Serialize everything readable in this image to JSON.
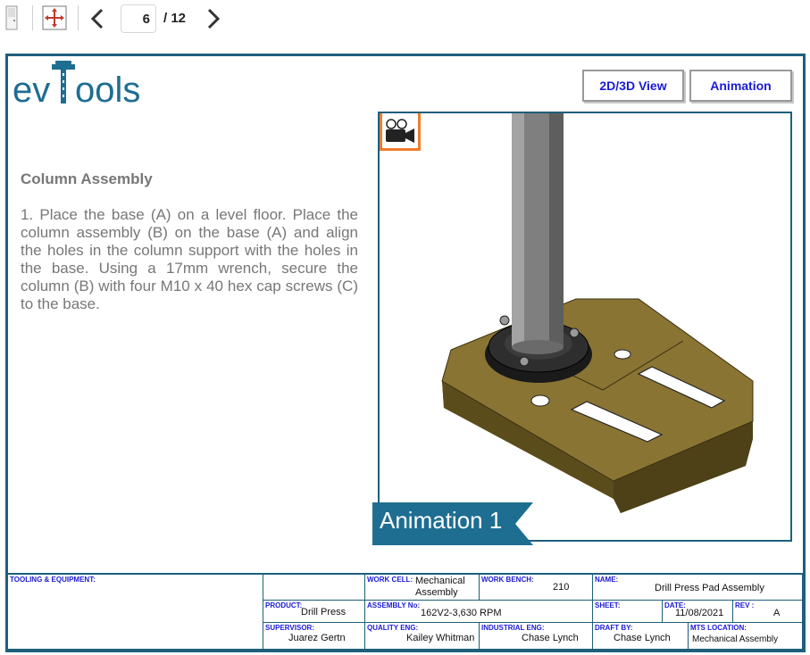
{
  "toolbar": {
    "current_page": "6",
    "total_pages": "/ 12",
    "icons": [
      "door-icon",
      "fit-screen-icon",
      "previous-page-icon",
      "next-page-icon"
    ]
  },
  "logo": {
    "text": "evtools"
  },
  "buttons": {
    "view": "2D/3D View",
    "animation": "Animation"
  },
  "content": {
    "heading": "Column Assembly",
    "instructions": "1. Place the base (A) on a level floor. Place the column assembly (B) on the base (A) and align the holes in the column support with the holes in the base. Using a 17mm wrench, secure the column (B) with four  M10 x 40 hex cap screws (C) to the base."
  },
  "viewer": {
    "camera_icon": "video-camera-icon",
    "banner": "Animation 1"
  },
  "title_block": {
    "tooling_label": "TOOLING & EQUIPMENT:",
    "work_cell_label": "WORK CELL:",
    "work_cell_line1": "Mechanical",
    "work_cell_line2": "Assembly",
    "work_bench_label": "WORK BENCH:",
    "work_bench": "210",
    "name_label": "NAME:",
    "name": "Drill Press Pad  Assembly",
    "product_label": "PRODUCT:",
    "product": "Drill Press",
    "assembly_label": "ASSEMBLY No:",
    "assembly": "162V2-3,630 RPM",
    "sheet_label": "SHEET:",
    "sheet": "",
    "date_label": "DATE:",
    "date": "11/08/2021",
    "rev_label": "REV :",
    "rev": "A",
    "supervisor_label": "SUPERVISOR:",
    "supervisor": "Juarez Gertn",
    "quality_label": "QUALITY ENG:",
    "quality": "Kailey Whitman",
    "industrial_label": "INDUSTRIAL ENG:",
    "industrial": "Chase Lynch",
    "draft_label": "DRAFT BY:",
    "draft": "Chase Lynch",
    "mts_label": "MTS LOCATION:",
    "mts": "Mechanical Assembly"
  },
  "colors": {
    "frame": "#1e5f7c",
    "accent": "#f07c2a",
    "button_text": "#1a1ad6",
    "base_plate": "#8a7434"
  }
}
